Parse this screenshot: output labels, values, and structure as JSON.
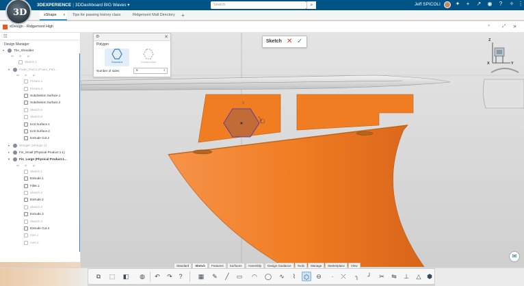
{
  "topbar": {
    "brand": "3D",
    "app": "3DEXPERIENCE",
    "separator": "|",
    "dashboard": "3DDashboard BIG Waves",
    "search_placeholder": "Search",
    "user": "Jeff SPICOLI",
    "icons": [
      "search-icon",
      "add-icon",
      "share-icon",
      "home-icon",
      "notification-icon",
      "help-icon"
    ]
  },
  "tabs": [
    {
      "label": "xShape",
      "active": true
    },
    {
      "label": "Tips for passing history class",
      "active": false
    },
    {
      "label": "Ridgemont Mall Directory",
      "active": false
    }
  ],
  "add_tab": "+",
  "doc": {
    "title": "xDesign - Ridgemont High"
  },
  "tree": {
    "panel_title": "Design Manager",
    "rows": [
      {
        "label": "The_Shredder",
        "indent": 0,
        "icon": "prod",
        "expander": "▾",
        "style": ""
      },
      {
        "label": "__sub",
        "indent": 1
      },
      {
        "label": "Sketch.1",
        "indent": 2,
        "icon": "sketch",
        "style": "dim"
      },
      {
        "label": "Foam_Part.2 (Foam_Part...",
        "indent": 1,
        "icon": "prod",
        "expander": "▾",
        "style": "dim"
      },
      {
        "label": "__sub",
        "indent": 2
      },
      {
        "label": "Picture.1",
        "indent": 3,
        "icon": "sketch",
        "style": "dim"
      },
      {
        "label": "Picture.2",
        "indent": 3,
        "icon": "sketch",
        "style": "dim"
      },
      {
        "label": "Subdivision Surface.1",
        "indent": 3,
        "icon": "feat",
        "style": ""
      },
      {
        "label": "Subdivision Surface.2",
        "indent": 3,
        "icon": "feat",
        "style": ""
      },
      {
        "label": "Sketch.5",
        "indent": 3,
        "icon": "sketch",
        "style": "dim"
      },
      {
        "label": "Sketch.6",
        "indent": 3,
        "icon": "sketch",
        "style": "dim"
      },
      {
        "label": "Knit Surface.1",
        "indent": 3,
        "icon": "feat",
        "style": ""
      },
      {
        "label": "Knit Surface.2",
        "indent": 3,
        "icon": "feat",
        "style": ""
      },
      {
        "label": "Extrude Cut.2",
        "indent": 3,
        "icon": "feat",
        "style": ""
      },
      {
        "label": "Stringer (Stringer.1)",
        "indent": 1,
        "icon": "prod",
        "expander": "▸",
        "style": "dim"
      },
      {
        "label": "Fin_Small (Physical Product.1.1)",
        "indent": 1,
        "icon": "prod",
        "expander": "▸",
        "style": ""
      },
      {
        "label": "Fin_Large (Physical Product.1...",
        "indent": 1,
        "icon": "prod",
        "expander": "▾",
        "style": "bold"
      },
      {
        "label": "__sub",
        "indent": 2
      },
      {
        "label": "Sketch.1",
        "indent": 3,
        "icon": "sketch",
        "style": "dim"
      },
      {
        "label": "Extrude.1",
        "indent": 3,
        "icon": "feat",
        "style": ""
      },
      {
        "label": "Fillet.1",
        "indent": 3,
        "icon": "feat",
        "style": ""
      },
      {
        "label": "Sketch.2",
        "indent": 3,
        "icon": "sketch",
        "style": "dim"
      },
      {
        "label": "Extrude.2",
        "indent": 3,
        "icon": "feat",
        "style": ""
      },
      {
        "label": "Sketch.3",
        "indent": 3,
        "icon": "sketch",
        "style": "dim"
      },
      {
        "label": "Extrude.3",
        "indent": 3,
        "icon": "feat",
        "style": ""
      },
      {
        "label": "Sketch.4",
        "indent": 3,
        "icon": "sketch",
        "style": "dim"
      },
      {
        "label": "Extrude Cut.4",
        "indent": 3,
        "icon": "feat",
        "style": ""
      },
      {
        "label": "Axis.1",
        "indent": 3,
        "icon": "sketch",
        "style": "dim"
      },
      {
        "label": "Axis.2",
        "indent": 3,
        "icon": "sketch",
        "style": "dim"
      }
    ],
    "sub_labels": [
      "sk",
      "sf",
      "pl"
    ]
  },
  "dialog": {
    "title": "Polygon",
    "mode_standard": "Standard",
    "mode_construction": "Construction",
    "sides_label": "Number of sides",
    "sides_value": "6"
  },
  "sketch_badge": {
    "label": "Sketch",
    "cancel": "✕",
    "ok": "✓"
  },
  "viewport": {
    "vertex_label": "V",
    "compass": {
      "z": "Z",
      "x": "X",
      "y": "Y"
    },
    "fin_color": "#f07d22"
  },
  "toolbar_tabs": [
    "Standard",
    "Sketch",
    "Features",
    "Surfaces",
    "Assembly",
    "Design Guidance",
    "Tools",
    "Manage",
    "Marketplace",
    "View"
  ],
  "active_toolbar_tab": "Sketch",
  "colors": {
    "brand_blue": "#005386",
    "fin_orange": "#f07d22",
    "selection_blue": "#2a7fc0"
  }
}
